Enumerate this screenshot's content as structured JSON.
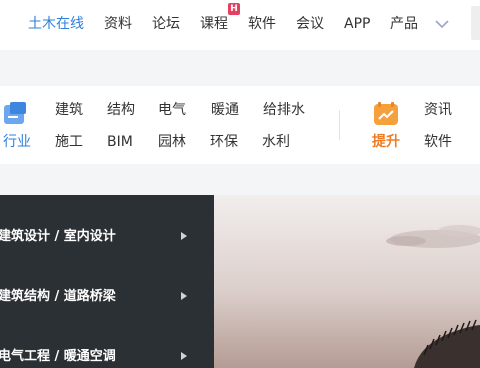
{
  "topnav": {
    "items": [
      "土木在线",
      "资料",
      "论坛",
      "课程",
      "软件",
      "会议",
      "APP",
      "产品"
    ],
    "badge": "H"
  },
  "categories": {
    "industry_label": "行业",
    "industry_links": [
      "建筑",
      "结构",
      "电气",
      "暖通",
      "给排水",
      "施工",
      "BIM",
      "园林",
      "环保",
      "水利"
    ],
    "upgrade_label": "提升",
    "upgrade_links": [
      "资讯",
      "软件"
    ],
    "icon_industry": "document-icon",
    "icon_upgrade": "trend-up-icon"
  },
  "sidebar": {
    "items": [
      "建筑设计 / 室内设计",
      "建筑结构 / 道路桥梁",
      "电气工程 / 暖通空调"
    ]
  },
  "colors": {
    "accent_blue": "#2f7fd9",
    "accent_orange": "#ef7c24",
    "badge_red": "#e54060",
    "sidebar_bg": "#2b3035"
  }
}
